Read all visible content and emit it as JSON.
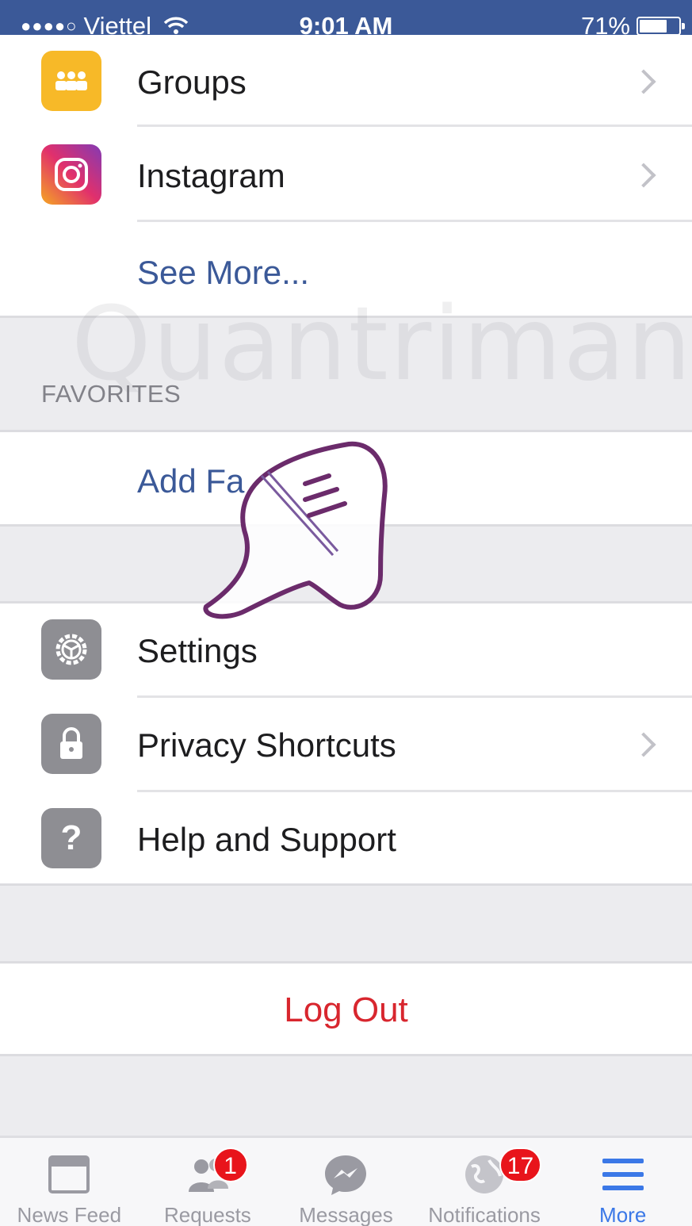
{
  "status_bar": {
    "signal_dots": "●●●●○",
    "carrier": "Viettel",
    "time": "9:01 AM",
    "battery_percent": "71%",
    "battery_level": 0.71
  },
  "menu": {
    "top_items": [
      {
        "label": "Groups",
        "icon": "groups-icon",
        "color": "#f7b928"
      },
      {
        "label": "Instagram",
        "icon": "instagram-icon",
        "color": "#c13584"
      }
    ],
    "see_more": "See More...",
    "favorites_header": "FAVORITES",
    "add_favorites": "Add Fa",
    "bottom_items": [
      {
        "label": "Settings",
        "icon": "gear-icon"
      },
      {
        "label": "Privacy Shortcuts",
        "icon": "lock-icon"
      },
      {
        "label": "Help and Support",
        "icon": "question-icon"
      }
    ],
    "logout": "Log Out"
  },
  "watermark": "Quantrimang",
  "tabbar": {
    "tabs": [
      {
        "label": "News Feed",
        "icon": "news-feed-icon",
        "badge": ""
      },
      {
        "label": "Requests",
        "icon": "friend-requests-icon",
        "badge": "1"
      },
      {
        "label": "Messages",
        "icon": "messenger-icon",
        "badge": ""
      },
      {
        "label": "Notifications",
        "icon": "globe-icon",
        "badge": "17"
      },
      {
        "label": "More",
        "icon": "menu-icon",
        "badge": "",
        "active": true
      }
    ]
  },
  "colors": {
    "brand": "#3b5998",
    "link": "#3b5998",
    "logout": "#d8262e",
    "active_tab": "#3b78e7",
    "badge": "#e8141b"
  }
}
